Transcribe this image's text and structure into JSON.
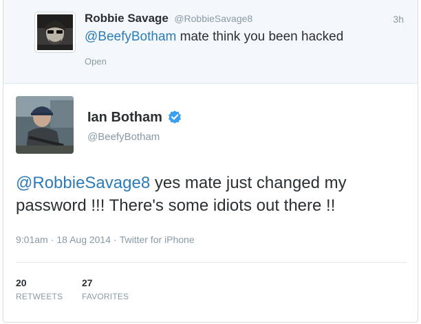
{
  "parent_tweet": {
    "name": "Robbie Savage",
    "handle": "@RobbieSavage8",
    "time": "3h",
    "mention": "@BeefyBotham",
    "text_rest": " mate think you been hacked",
    "open_label": "Open"
  },
  "main_tweet": {
    "name": "Ian Botham",
    "handle": "@BeefyBotham",
    "mention": "@RobbieSavage8",
    "text_rest": " yes mate just changed my password !!! There's some idiots out there !!",
    "time": "9:01am",
    "date": "18 Aug 2014",
    "source": "Twitter for iPhone",
    "separator": "·"
  },
  "stats": {
    "retweets": {
      "count": "20",
      "label": "RETWEETS"
    },
    "favorites": {
      "count": "27",
      "label": "FAVORITES"
    }
  },
  "colors": {
    "link": "#2b7bb9",
    "muted": "#8899a6",
    "text": "#292f33",
    "verified": "#3a9ff0"
  },
  "icons": {
    "verified": "verified-badge-icon"
  }
}
